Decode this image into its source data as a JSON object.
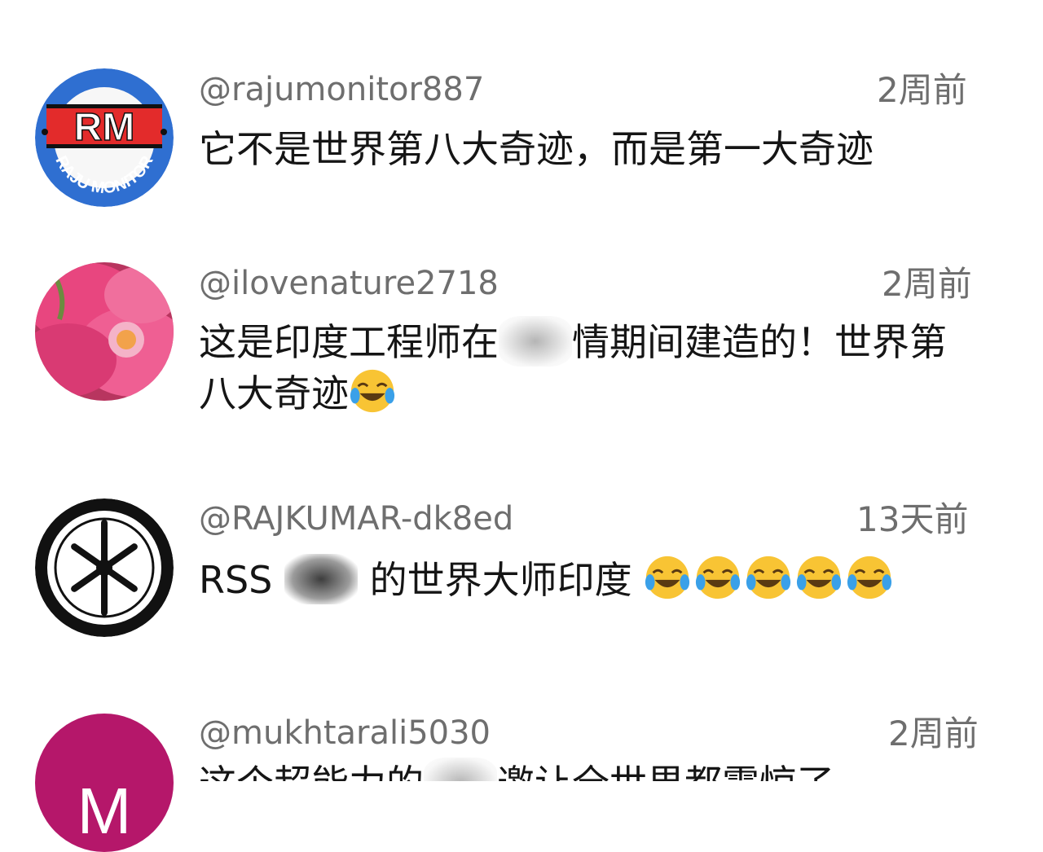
{
  "comments": [
    {
      "handle": "@rajumonitor887",
      "time": "2周前",
      "text": "它不是世界第八大奇迹，而是第一大奇迹",
      "avatar": {
        "logo_text": "RM",
        "ring_text": "RAJU MONITOR",
        "colors": {
          "ring": "#2f6fd1",
          "inner": "#e32b2b",
          "band": "#ffffff"
        }
      }
    },
    {
      "handle": "@ilovenature2718",
      "time": "2周前",
      "text_line1_a": "这是印度工程师在",
      "text_line1_b": "情期间建造的！世界第",
      "text_line2": "八大奇迹",
      "avatar": {
        "kind": "pink-flower-photo",
        "colors": {
          "petal": "#e8467f",
          "center": "#f2a24b"
        }
      }
    },
    {
      "handle": "@RAJKUMAR-dk8ed",
      "time": "13天前",
      "text_a": "RSS",
      "text_b": "的世界大师印度",
      "emoji_count": 5,
      "avatar": {
        "kind": "tuning-fork-emblem",
        "colors": {
          "ring": "#111111",
          "bg": "#ffffff"
        }
      }
    },
    {
      "handle": "@mukhtarali5030",
      "time": "2周前",
      "text_a": "这个超能力的",
      "text_b": "邀让全世界都震惊了",
      "avatar": {
        "letter": "M",
        "colors": {
          "bg": "#b5176a",
          "fg": "#ffffff"
        }
      }
    }
  ],
  "icons": {
    "emoji": "face-with-tears-of-joy-icon"
  },
  "colors": {
    "meta_text": "#6e6e6e",
    "body_text": "#151515"
  }
}
